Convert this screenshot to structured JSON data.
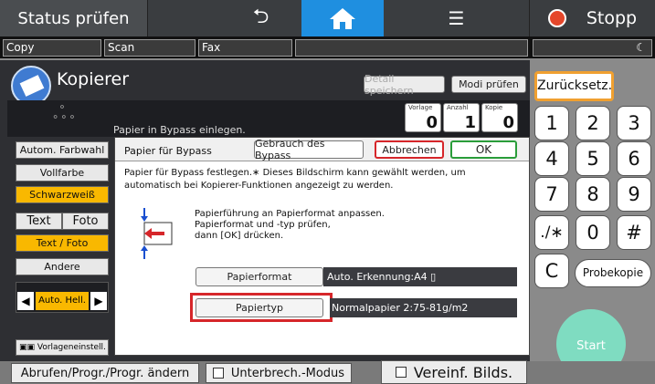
{
  "topbar": {
    "status_label": "Status prüfen",
    "stop_label": "Stopp"
  },
  "tabs": [
    "Copy",
    "Scan",
    "Fax"
  ],
  "copier": {
    "title": "Kopierer",
    "save_label": "Detail speichern",
    "check_label": "Modi prüfen",
    "message": "Papier in Bypass einlegen.",
    "counters": [
      {
        "label": "Vorlage",
        "value": "0"
      },
      {
        "label": "Anzahl",
        "value": "1"
      },
      {
        "label": "Kopie",
        "value": "0"
      }
    ]
  },
  "side": {
    "auto_color": "Autom. Farbwahl",
    "full_color": "Vollfarbe",
    "bw": "Schwarzweiß",
    "text": "Text",
    "photo": "Foto",
    "text_photo": "Text / Foto",
    "other": "Andere",
    "auto_light": "Auto. Hell.",
    "original_settings": "Vorlageneinstell."
  },
  "dialog": {
    "title": "Papier für Bypass",
    "use_bypass": "Gebrauch des Bypass",
    "cancel": "Abbrechen",
    "ok": "OK",
    "desc1": "Papier für Bypass festlegen.∗ Dieses Bildschirm kann gewählt werden, um",
    "desc2": "automatisch bei Kopierer-Funktionen angezeigt zu werden.",
    "instr1": "Papierführung an Papierformat anpassen.",
    "instr2": "Papierformat und -typ prüfen,",
    "instr3": "dann [OK] drücken.",
    "format_label": "Papierformat",
    "format_value": "Auto. Erkennung:A4",
    "type_label": "Papiertyp",
    "type_value": "Normalpapier 2:75-81g/m2"
  },
  "right": {
    "reset": "Zurücksetz.",
    "keys": [
      "1",
      "2",
      "3",
      "4",
      "5",
      "6",
      "7",
      "8",
      "9",
      "./∗",
      "0",
      "#",
      "C"
    ],
    "sample_copy": "Probekopie",
    "start": "Start"
  },
  "bottom": {
    "recall": "Abrufen/Progr./Progr. ändern",
    "interrupt": "Unterbrech.-Modus",
    "simple": "Vereinf. Bilds."
  },
  "colors": {
    "accent_orange": "#f9b800",
    "highlight_red": "#d6262a",
    "start_green": "#7fdcc1"
  }
}
